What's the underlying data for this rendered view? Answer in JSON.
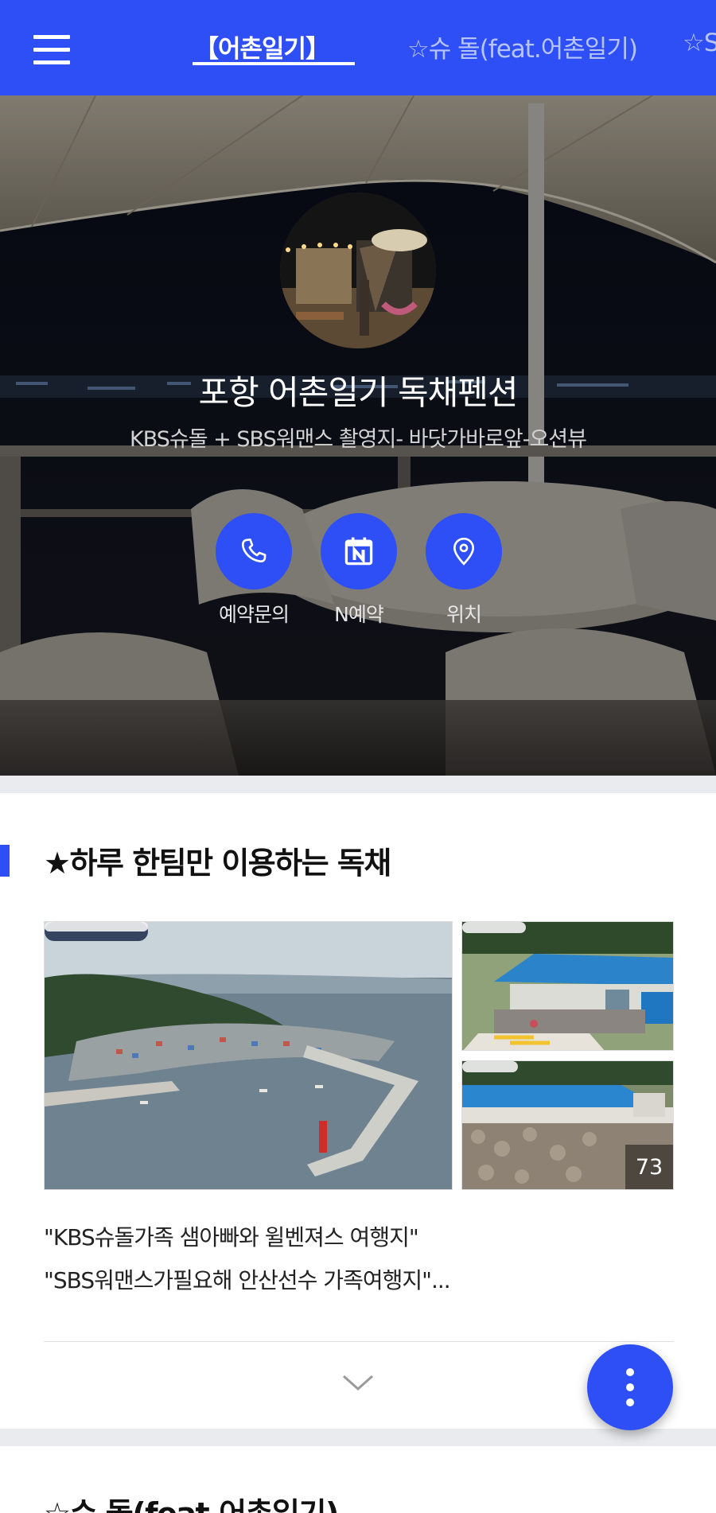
{
  "colors": {
    "accent": "#2e4ff5",
    "tab_inactive": "#b8c4ff",
    "band": "#e9ebee"
  },
  "header": {
    "menu_icon": "hamburger-menu-icon",
    "tabs": [
      {
        "label": "【어촌일기】",
        "active": true
      },
      {
        "label": "☆슈 돌(feat.어촌일기)",
        "active": false
      },
      {
        "label": "☆S",
        "active": false
      }
    ]
  },
  "hero": {
    "title": "포항 어촌일기 독채펜션",
    "subtitle": "KBS슈돌 + SBS워맨스 촬영지- 바닷가바로앞-오션뷰",
    "actions": [
      {
        "label": "예약문의",
        "icon": "phone-icon"
      },
      {
        "label": "N예약",
        "icon": "naver-booking-calendar-icon"
      },
      {
        "label": "위치",
        "icon": "location-pin-icon"
      }
    ]
  },
  "section": {
    "title": "★하루 한팀만 이용하는 독채",
    "photo_count": "73",
    "description_lines": [
      "\"KBS슈돌가족 샘아빠와 윌벤져스 여행지\"",
      "\"SBS워맨스가필요해 안산선수 가족여행지\"..."
    ],
    "expand_icon": "chevron-down-icon"
  },
  "fab_icon": "more-vertical-icon",
  "next_section": {
    "title": "☆슈 돌(feat.어촌일기)"
  }
}
